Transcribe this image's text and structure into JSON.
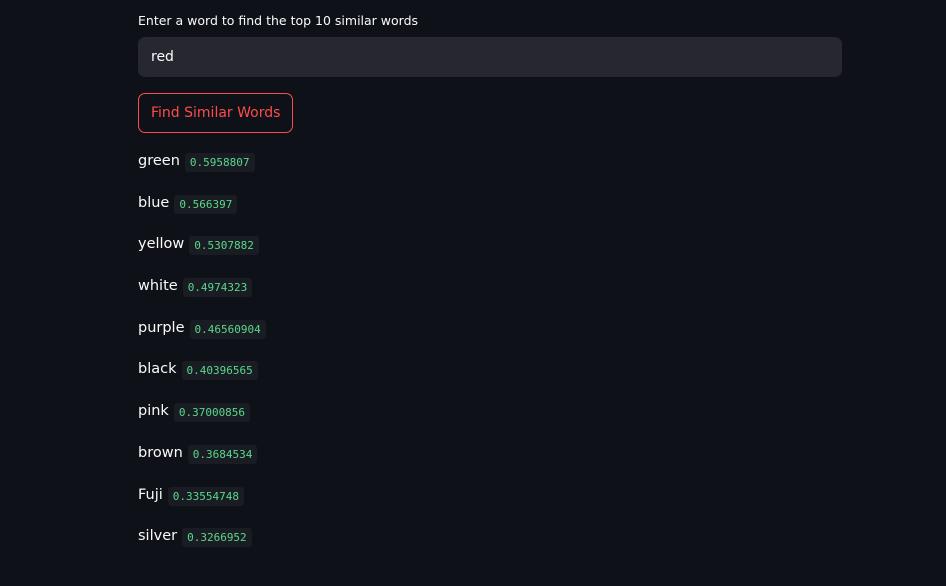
{
  "form": {
    "label": "Enter a word to find the top 10 similar words",
    "input_value": "red",
    "button_label": "Find Similar Words"
  },
  "results": [
    {
      "word": "green",
      "score": "0.5958807"
    },
    {
      "word": "blue",
      "score": "0.566397"
    },
    {
      "word": "yellow",
      "score": "0.5307882"
    },
    {
      "word": "white",
      "score": "0.4974323"
    },
    {
      "word": "purple",
      "score": "0.46560904"
    },
    {
      "word": "black",
      "score": "0.40396565"
    },
    {
      "word": "pink",
      "score": "0.37000856"
    },
    {
      "word": "brown",
      "score": "0.3684534"
    },
    {
      "word": "Fuji",
      "score": "0.33554748"
    },
    {
      "word": "silver",
      "score": "0.3266952"
    }
  ],
  "colors": {
    "background": "#0e1117",
    "input_background": "#262730",
    "accent": "#ff4b4b",
    "score_text": "#5ad88a",
    "score_background": "#1a1c24"
  }
}
